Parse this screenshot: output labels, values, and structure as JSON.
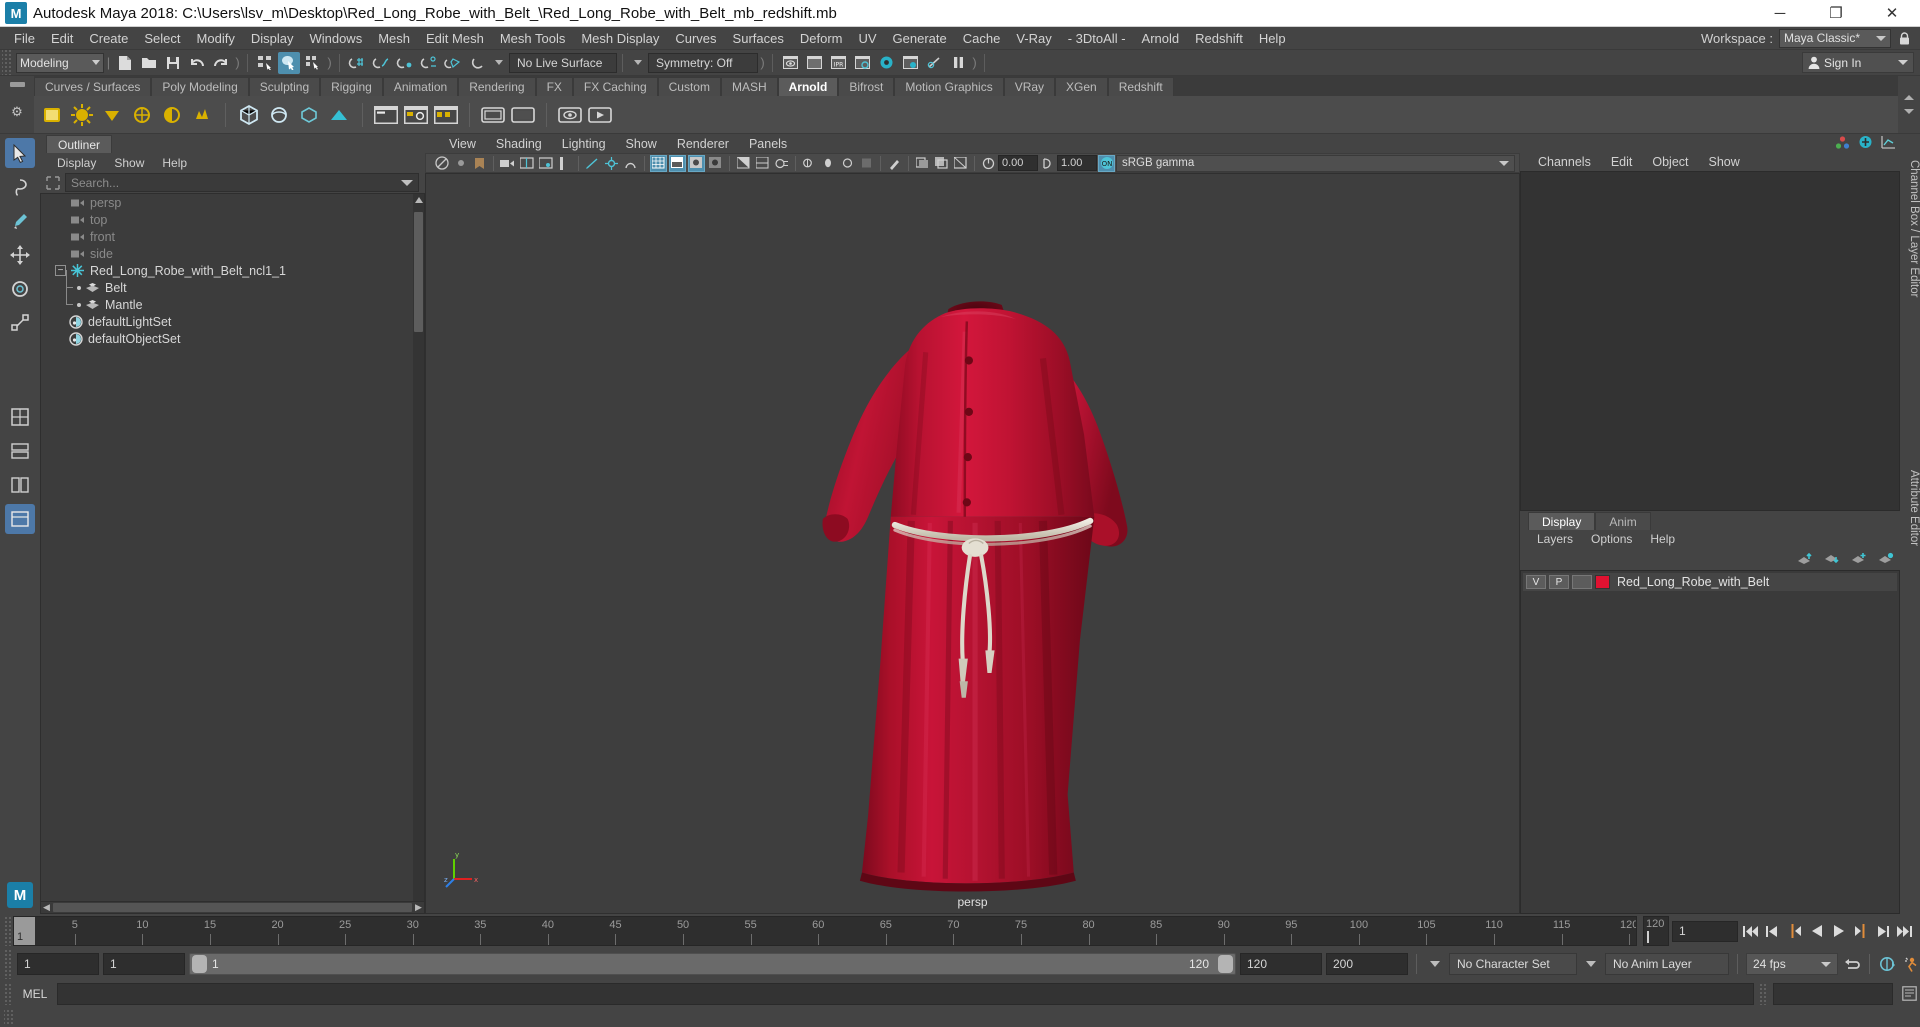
{
  "titlebar": {
    "app_title": "Autodesk Maya 2018: C:\\Users\\lsv_m\\Desktop\\Red_Long_Robe_with_Belt_\\Red_Long_Robe_with_Belt_mb_redshift.mb",
    "logo_text": "M",
    "minimize": "─",
    "maximize": "❐",
    "close": "✕"
  },
  "menubar": {
    "items": [
      "File",
      "Edit",
      "Create",
      "Select",
      "Modify",
      "Display",
      "Windows",
      "Mesh",
      "Edit Mesh",
      "Mesh Tools",
      "Mesh Display",
      "Curves",
      "Surfaces",
      "Deform",
      "UV",
      "Generate",
      "Cache",
      "V-Ray",
      "- 3DtoAll -",
      "Arnold",
      "Redshift",
      "Help"
    ],
    "workspace_label": "Workspace :",
    "workspace_value": "Maya Classic*"
  },
  "statusline": {
    "menuset_value": "Modeling",
    "live_surface": "No Live Surface",
    "symmetry": "Symmetry: Off",
    "signin": "Sign In"
  },
  "shelf": {
    "tabs": [
      "Curves / Surfaces",
      "Poly Modeling",
      "Sculpting",
      "Rigging",
      "Animation",
      "Rendering",
      "FX",
      "FX Caching",
      "Custom",
      "MASH",
      "Arnold",
      "Bifrost",
      "Motion Graphics",
      "VRay",
      "XGen",
      "Redshift"
    ],
    "active_tab": "Arnold"
  },
  "outliner": {
    "tab_label": "Outliner",
    "menu": [
      "Display",
      "Show",
      "Help"
    ],
    "search_placeholder": "Search...",
    "items": [
      {
        "label": "persp",
        "icon": "camera-icon",
        "type": "camera",
        "depth": 1
      },
      {
        "label": "top",
        "icon": "camera-icon",
        "type": "camera",
        "depth": 1
      },
      {
        "label": "front",
        "icon": "camera-icon",
        "type": "camera",
        "depth": 1
      },
      {
        "label": "side",
        "icon": "camera-icon",
        "type": "camera",
        "depth": 1
      },
      {
        "label": "Red_Long_Robe_with_Belt_ncl1_1",
        "icon": "nucleus-icon",
        "type": "group",
        "depth": 0
      },
      {
        "label": "Belt",
        "icon": "mesh-icon",
        "type": "mesh",
        "depth": 1
      },
      {
        "label": "Mantle",
        "icon": "mesh-icon",
        "type": "mesh",
        "depth": 1
      },
      {
        "label": "defaultLightSet",
        "icon": "set-icon",
        "type": "set",
        "depth": 1
      },
      {
        "label": "defaultObjectSet",
        "icon": "set-icon",
        "type": "set",
        "depth": 1
      }
    ]
  },
  "viewport": {
    "menu": [
      "View",
      "Shading",
      "Lighting",
      "Show",
      "Renderer",
      "Panels"
    ],
    "exposure_value": "0.00",
    "gamma_value": "1.00",
    "color_space": "sRGB gamma",
    "camera_label": "persp",
    "axis_x": "x",
    "axis_y": "y",
    "axis_z": "z",
    "model_colors": {
      "robe_base": "#b0102e",
      "robe_light": "#d4173c",
      "robe_dark": "#7d0a1f",
      "belt": "#d9d4c8",
      "background": "#3e3e3e"
    }
  },
  "channelbox": {
    "menu": [
      "Channels",
      "Edit",
      "Object",
      "Show"
    ],
    "side_label": "Channel Box / Layer Editor",
    "side_label_2": "Attribute Editor"
  },
  "layereditor": {
    "tabs": [
      "Display",
      "Anim"
    ],
    "active_tab": "Display",
    "menu": [
      "Layers",
      "Options",
      "Help"
    ],
    "layers": [
      {
        "visibility": "V",
        "playback": "P",
        "shading": "",
        "color": "#e01231",
        "name": "Red_Long_Robe_with_Belt"
      }
    ]
  },
  "timeslider": {
    "start": 1,
    "end": 120,
    "current_frame": "1",
    "ticks": [
      5,
      10,
      15,
      20,
      25,
      30,
      35,
      40,
      45,
      50,
      55,
      60,
      65,
      70,
      75,
      80,
      85,
      90,
      95,
      100,
      105,
      110,
      115,
      120
    ],
    "end_label": "120",
    "playback_field": "1"
  },
  "rangeslider": {
    "anim_start": "1",
    "range_start": "1",
    "slider_min_label": "1",
    "slider_max_label": "120",
    "range_end": "120",
    "anim_end": "200",
    "character_set": "No Character Set",
    "anim_layer": "No Anim Layer",
    "fps": "24 fps"
  },
  "mel": {
    "label": "MEL",
    "command_value": ""
  }
}
